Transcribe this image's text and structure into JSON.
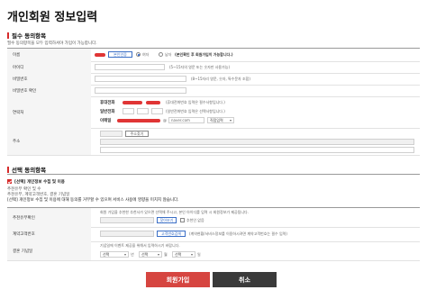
{
  "page": {
    "title": "개인회원 정보입력"
  },
  "required": {
    "section_title": "필수 동의항목",
    "note": "필수 동의항목을 모두 입력하셔야 가입이 가능합니다.",
    "fields": {
      "name": {
        "label": "이름",
        "auth_button": "본인인증",
        "gender": [
          "여자",
          "남자"
        ],
        "hint": "(본인확인 후 회원가입이 가능합니다.)"
      },
      "userid": {
        "label": "아이디",
        "hint": "(5~15자의 영문 또는 숫자만 사용가능)"
      },
      "password": {
        "label": "비밀번호",
        "hint": "(8~15자리 영문, 숫자, 특수문자 조합)"
      },
      "password_confirm": {
        "label": "비밀번호 확인"
      },
      "contact": {
        "label": "연락처",
        "mobile_label": "휴대전화",
        "mobile_hint": "(휴대전화번호 입력은 필수사항입니다.)",
        "phone_label": "일반전화",
        "phone_hint": "(일반전화번호 입력은 선택사항입니다.)",
        "email_label": "이메일",
        "email_at": "@",
        "email_domain": "naver.com",
        "email_select": "직접입력"
      },
      "address": {
        "label": "주소",
        "search_button": "주소찾기"
      }
    }
  },
  "optional": {
    "section_title": "선택 동의항목",
    "consent_label": "[선택] 개인정보 수집 및 이용",
    "purpose_lines": [
      "추천유무 확인 및 수",
      "추천유부, 계약고객번호, 결혼 기념일"
    ],
    "notice": "[선택] 개인정보 수집 및 이용에 대해 동의를 거부할 수 있으며 서비스 사용에 영향을 미치지 않습니다.",
    "fields": {
      "referrer": {
        "label": "추천유무확인",
        "desc": "회원 가입을 추천한 추천사가 있으면 선택해 주시고, 본인 아이디를 입력 시 회원정보가 제공됩니다.",
        "find_button": "찾아보기",
        "checkbox_label": "추천인 없음"
      },
      "contract": {
        "label": "계약고객번호",
        "search_button": "고객번호검색",
        "hint": "(계약현황/서비스정보를 이용하시려면 계약고객번호는 필수 입력)"
      },
      "anniversary": {
        "label": "결혼 기념일",
        "desc": "기념일에 이벤트 제공을 위해서 입력하시기 바랍니다.",
        "year": "선택",
        "month": "선택",
        "day": "선택",
        "units": [
          "년",
          "월",
          "일"
        ]
      }
    }
  },
  "actions": {
    "submit": "회원가입",
    "cancel": "취소"
  },
  "colors": {
    "accent": "#d62b2b",
    "submit_bg": "#d64540",
    "cancel_bg": "#3a3a3a"
  }
}
